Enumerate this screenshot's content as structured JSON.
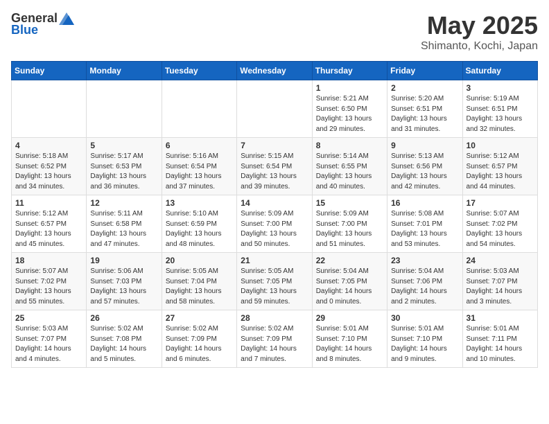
{
  "logo": {
    "general": "General",
    "blue": "Blue"
  },
  "title": "May 2025",
  "location": "Shimanto, Kochi, Japan",
  "days": [
    "Sunday",
    "Monday",
    "Tuesday",
    "Wednesday",
    "Thursday",
    "Friday",
    "Saturday"
  ],
  "weeks": [
    [
      {
        "num": "",
        "info": ""
      },
      {
        "num": "",
        "info": ""
      },
      {
        "num": "",
        "info": ""
      },
      {
        "num": "",
        "info": ""
      },
      {
        "num": "1",
        "info": "Sunrise: 5:21 AM\nSunset: 6:50 PM\nDaylight: 13 hours\nand 29 minutes."
      },
      {
        "num": "2",
        "info": "Sunrise: 5:20 AM\nSunset: 6:51 PM\nDaylight: 13 hours\nand 31 minutes."
      },
      {
        "num": "3",
        "info": "Sunrise: 5:19 AM\nSunset: 6:51 PM\nDaylight: 13 hours\nand 32 minutes."
      }
    ],
    [
      {
        "num": "4",
        "info": "Sunrise: 5:18 AM\nSunset: 6:52 PM\nDaylight: 13 hours\nand 34 minutes."
      },
      {
        "num": "5",
        "info": "Sunrise: 5:17 AM\nSunset: 6:53 PM\nDaylight: 13 hours\nand 36 minutes."
      },
      {
        "num": "6",
        "info": "Sunrise: 5:16 AM\nSunset: 6:54 PM\nDaylight: 13 hours\nand 37 minutes."
      },
      {
        "num": "7",
        "info": "Sunrise: 5:15 AM\nSunset: 6:54 PM\nDaylight: 13 hours\nand 39 minutes."
      },
      {
        "num": "8",
        "info": "Sunrise: 5:14 AM\nSunset: 6:55 PM\nDaylight: 13 hours\nand 40 minutes."
      },
      {
        "num": "9",
        "info": "Sunrise: 5:13 AM\nSunset: 6:56 PM\nDaylight: 13 hours\nand 42 minutes."
      },
      {
        "num": "10",
        "info": "Sunrise: 5:12 AM\nSunset: 6:57 PM\nDaylight: 13 hours\nand 44 minutes."
      }
    ],
    [
      {
        "num": "11",
        "info": "Sunrise: 5:12 AM\nSunset: 6:57 PM\nDaylight: 13 hours\nand 45 minutes."
      },
      {
        "num": "12",
        "info": "Sunrise: 5:11 AM\nSunset: 6:58 PM\nDaylight: 13 hours\nand 47 minutes."
      },
      {
        "num": "13",
        "info": "Sunrise: 5:10 AM\nSunset: 6:59 PM\nDaylight: 13 hours\nand 48 minutes."
      },
      {
        "num": "14",
        "info": "Sunrise: 5:09 AM\nSunset: 7:00 PM\nDaylight: 13 hours\nand 50 minutes."
      },
      {
        "num": "15",
        "info": "Sunrise: 5:09 AM\nSunset: 7:00 PM\nDaylight: 13 hours\nand 51 minutes."
      },
      {
        "num": "16",
        "info": "Sunrise: 5:08 AM\nSunset: 7:01 PM\nDaylight: 13 hours\nand 53 minutes."
      },
      {
        "num": "17",
        "info": "Sunrise: 5:07 AM\nSunset: 7:02 PM\nDaylight: 13 hours\nand 54 minutes."
      }
    ],
    [
      {
        "num": "18",
        "info": "Sunrise: 5:07 AM\nSunset: 7:02 PM\nDaylight: 13 hours\nand 55 minutes."
      },
      {
        "num": "19",
        "info": "Sunrise: 5:06 AM\nSunset: 7:03 PM\nDaylight: 13 hours\nand 57 minutes."
      },
      {
        "num": "20",
        "info": "Sunrise: 5:05 AM\nSunset: 7:04 PM\nDaylight: 13 hours\nand 58 minutes."
      },
      {
        "num": "21",
        "info": "Sunrise: 5:05 AM\nSunset: 7:05 PM\nDaylight: 13 hours\nand 59 minutes."
      },
      {
        "num": "22",
        "info": "Sunrise: 5:04 AM\nSunset: 7:05 PM\nDaylight: 14 hours\nand 0 minutes."
      },
      {
        "num": "23",
        "info": "Sunrise: 5:04 AM\nSunset: 7:06 PM\nDaylight: 14 hours\nand 2 minutes."
      },
      {
        "num": "24",
        "info": "Sunrise: 5:03 AM\nSunset: 7:07 PM\nDaylight: 14 hours\nand 3 minutes."
      }
    ],
    [
      {
        "num": "25",
        "info": "Sunrise: 5:03 AM\nSunset: 7:07 PM\nDaylight: 14 hours\nand 4 minutes."
      },
      {
        "num": "26",
        "info": "Sunrise: 5:02 AM\nSunset: 7:08 PM\nDaylight: 14 hours\nand 5 minutes."
      },
      {
        "num": "27",
        "info": "Sunrise: 5:02 AM\nSunset: 7:09 PM\nDaylight: 14 hours\nand 6 minutes."
      },
      {
        "num": "28",
        "info": "Sunrise: 5:02 AM\nSunset: 7:09 PM\nDaylight: 14 hours\nand 7 minutes."
      },
      {
        "num": "29",
        "info": "Sunrise: 5:01 AM\nSunset: 7:10 PM\nDaylight: 14 hours\nand 8 minutes."
      },
      {
        "num": "30",
        "info": "Sunrise: 5:01 AM\nSunset: 7:10 PM\nDaylight: 14 hours\nand 9 minutes."
      },
      {
        "num": "31",
        "info": "Sunrise: 5:01 AM\nSunset: 7:11 PM\nDaylight: 14 hours\nand 10 minutes."
      }
    ]
  ]
}
